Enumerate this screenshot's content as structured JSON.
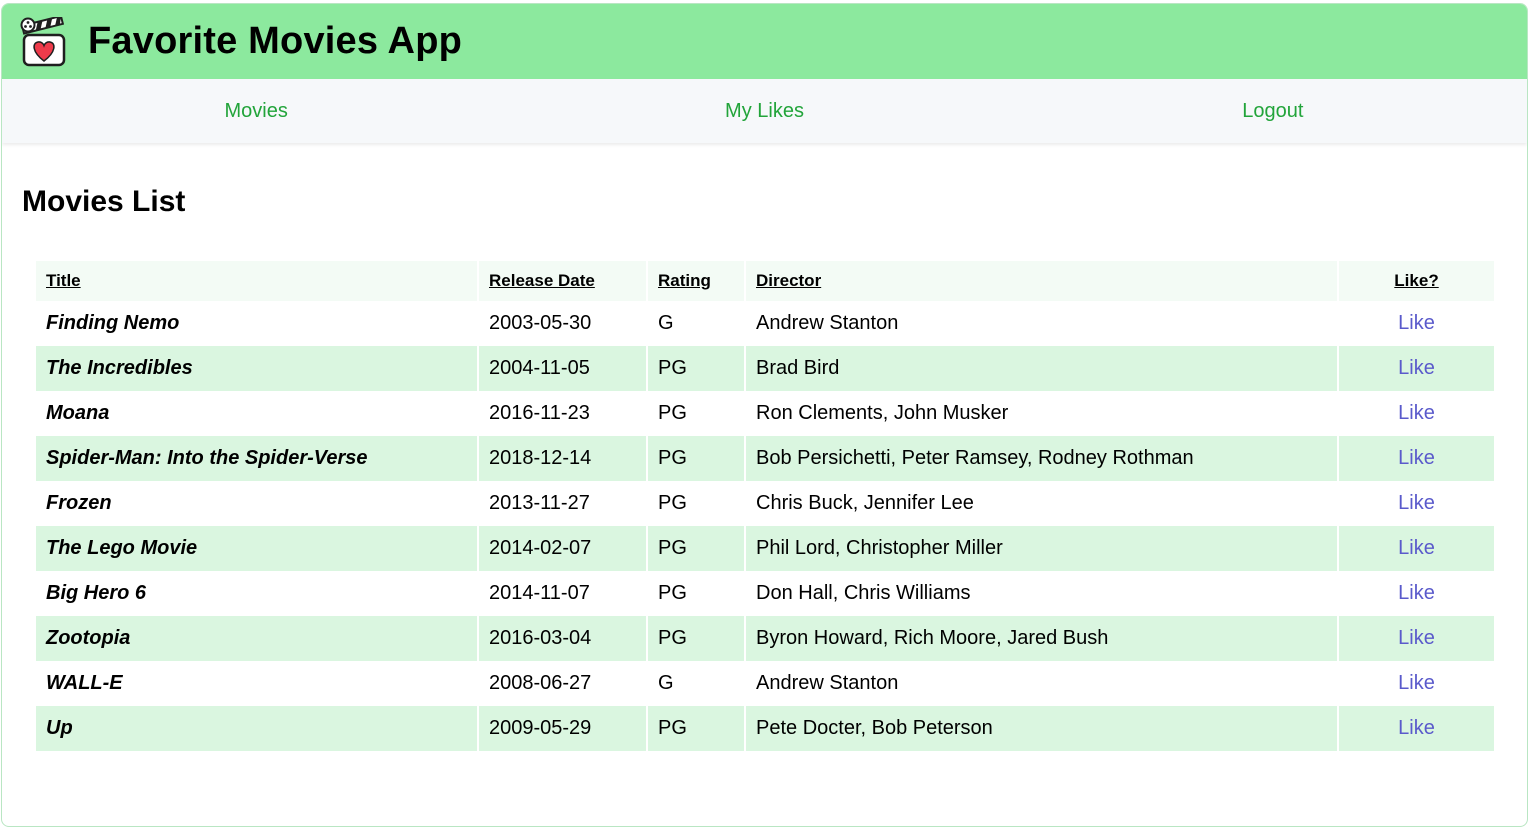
{
  "header": {
    "title": "Favorite Movies App",
    "logo_icon": "clapperboard-heart-icon"
  },
  "nav": {
    "items": [
      {
        "label": "Movies"
      },
      {
        "label": "My Likes"
      },
      {
        "label": "Logout"
      }
    ]
  },
  "main": {
    "heading": "Movies List"
  },
  "table": {
    "columns": [
      "Title",
      "Release Date",
      "Rating",
      "Director",
      "Like?"
    ],
    "like_label": "Like",
    "rows": [
      {
        "title": "Finding Nemo",
        "release_date": "2003-05-30",
        "rating": "G",
        "director": "Andrew Stanton"
      },
      {
        "title": "The Incredibles",
        "release_date": "2004-11-05",
        "rating": "PG",
        "director": "Brad Bird"
      },
      {
        "title": "Moana",
        "release_date": "2016-11-23",
        "rating": "PG",
        "director": "Ron Clements, John Musker"
      },
      {
        "title": "Spider-Man: Into the Spider-Verse",
        "release_date": "2018-12-14",
        "rating": "PG",
        "director": "Bob Persichetti, Peter Ramsey, Rodney Rothman"
      },
      {
        "title": "Frozen",
        "release_date": "2013-11-27",
        "rating": "PG",
        "director": "Chris Buck, Jennifer Lee"
      },
      {
        "title": "The Lego Movie",
        "release_date": "2014-02-07",
        "rating": "PG",
        "director": "Phil Lord, Christopher Miller"
      },
      {
        "title": "Big Hero 6",
        "release_date": "2014-11-07",
        "rating": "PG",
        "director": "Don Hall, Chris Williams"
      },
      {
        "title": "Zootopia",
        "release_date": "2016-03-04",
        "rating": "PG",
        "director": "Byron Howard, Rich Moore, Jared Bush"
      },
      {
        "title": "WALL-E",
        "release_date": "2008-06-27",
        "rating": "G",
        "director": "Andrew Stanton"
      },
      {
        "title": "Up",
        "release_date": "2009-05-29",
        "rating": "PG",
        "director": "Pete Docter, Bob Peterson"
      }
    ]
  },
  "colors": {
    "header_bg": "#8ce99e",
    "nav_link": "#22a43a",
    "row_stripe": "#daf6e0",
    "like_link": "#5a5acb"
  }
}
